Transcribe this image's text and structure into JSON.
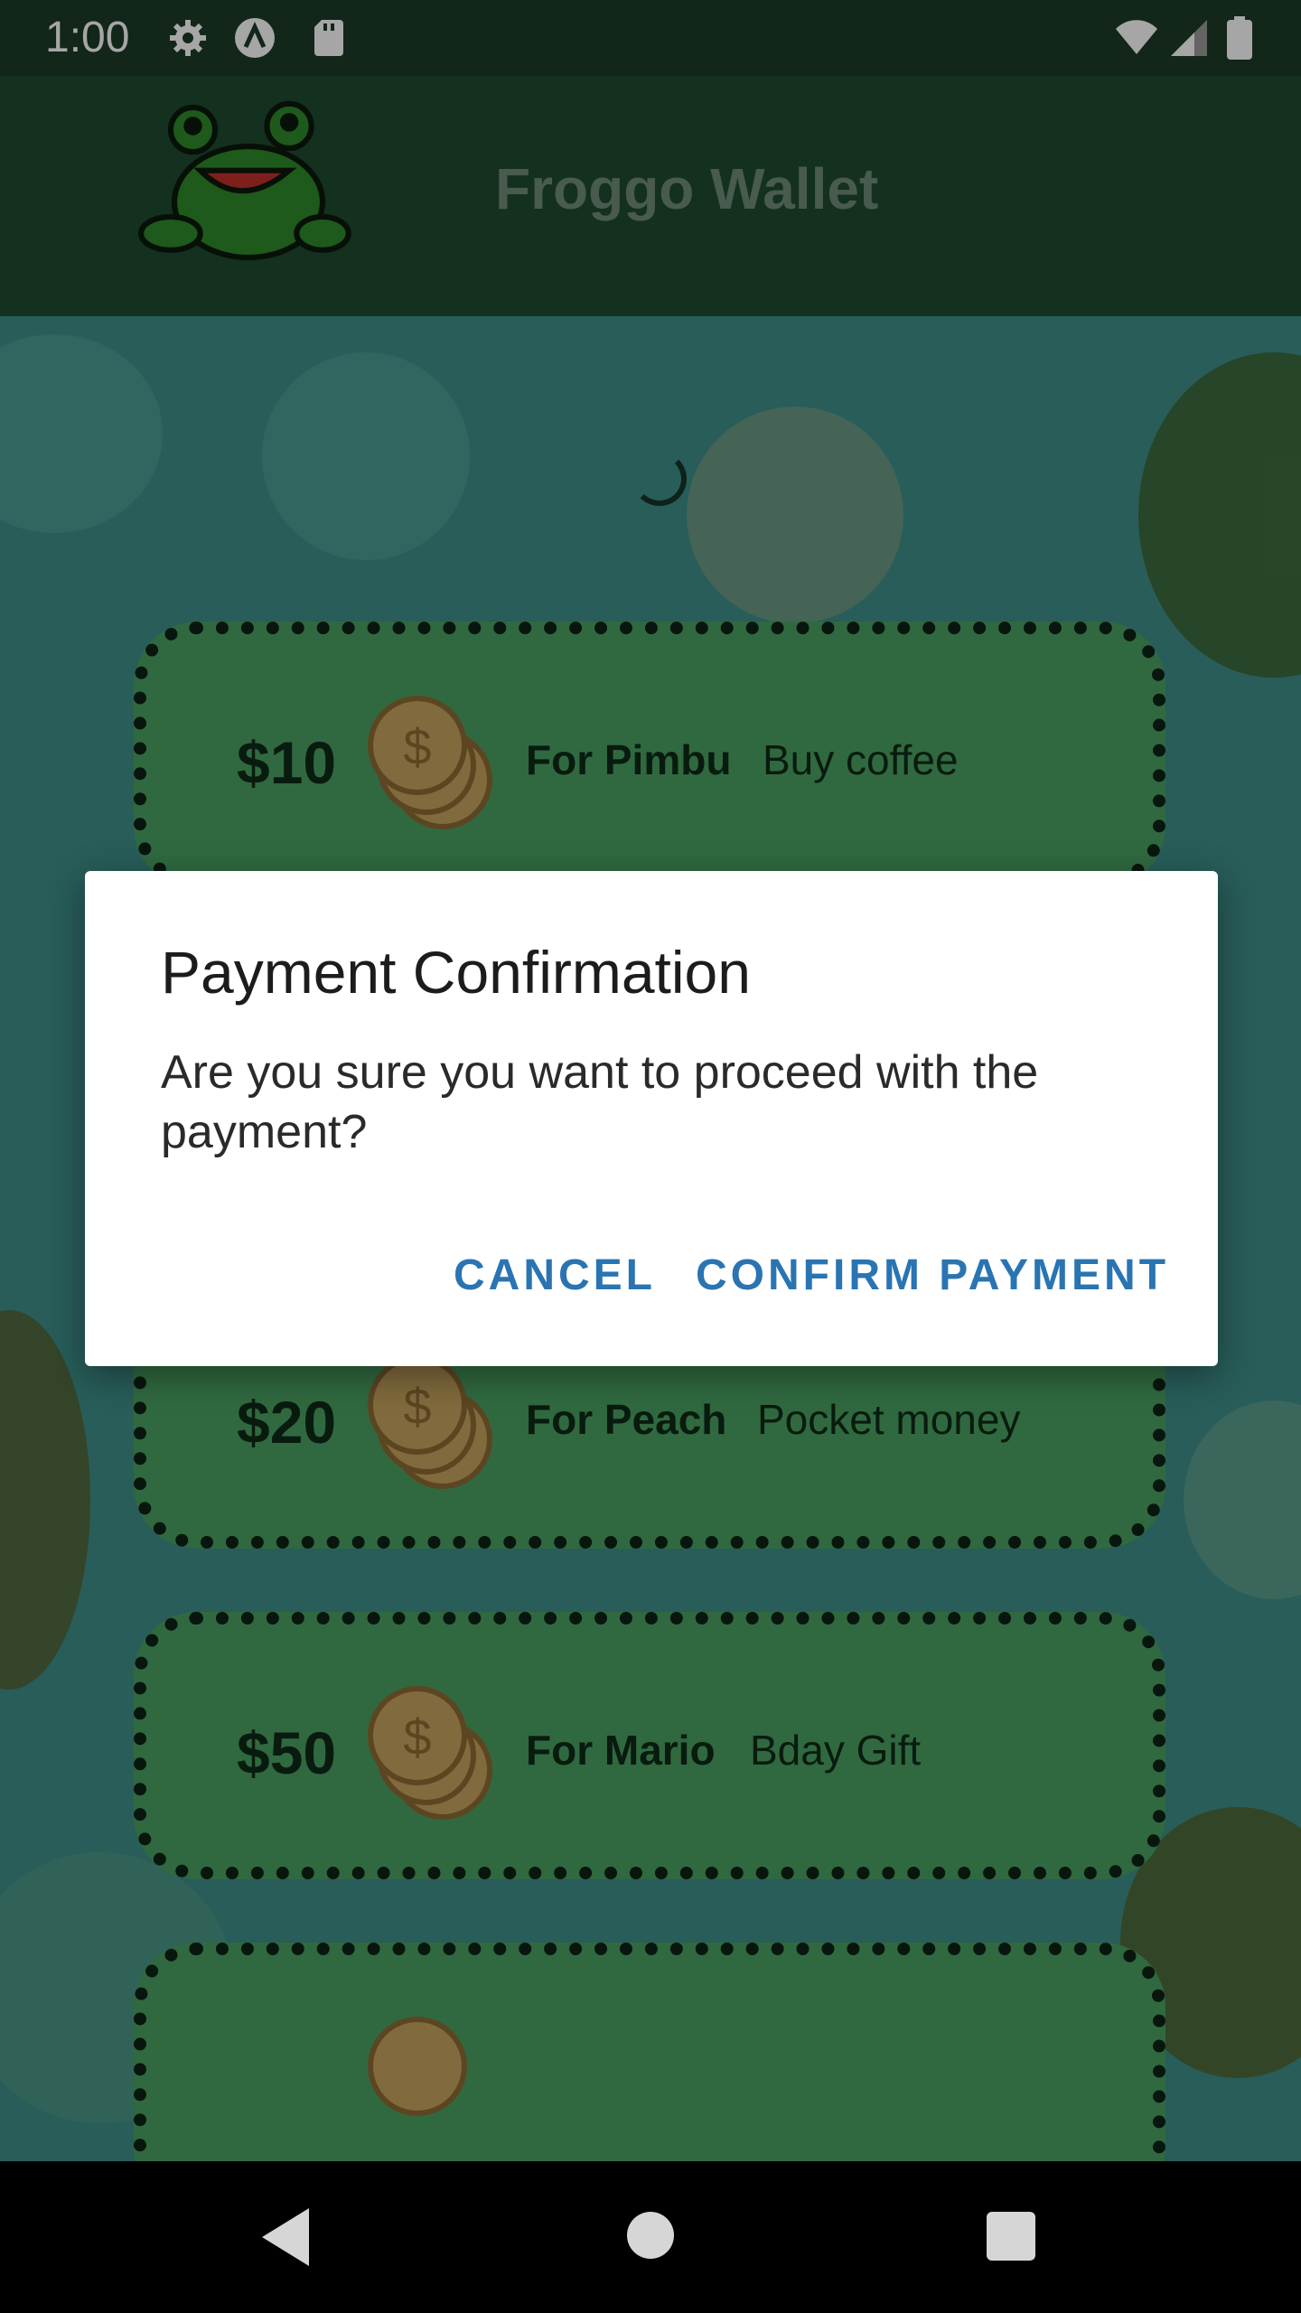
{
  "status_bar": {
    "time": "1:00",
    "icons_left": [
      "gear-icon",
      "a-circle-icon",
      "sd-card-icon"
    ],
    "icons_right": [
      "wifi-icon",
      "signal-icon",
      "battery-icon"
    ]
  },
  "app_bar": {
    "title": "Froggo Wallet",
    "logo": "frog-logo"
  },
  "payments": [
    {
      "amount": "$10",
      "recipient": "For Pimbu",
      "memo": "Buy coffee"
    },
    {
      "amount": "$20",
      "recipient": "For Peach",
      "memo": "Pocket money"
    },
    {
      "amount": "$50",
      "recipient": "For Mario",
      "memo": "Bday Gift"
    }
  ],
  "dialog": {
    "title": "Payment Confirmation",
    "message": "Are you sure you want to proceed with the payment?",
    "cancel_label": "CANCEL",
    "confirm_label": "CONFIRM PAYMENT"
  },
  "nav_bar": {
    "back": "back-icon",
    "home": "home-icon",
    "recents": "recents-icon"
  },
  "colors": {
    "status_bar": "#1c3b29",
    "app_bar": "#1f4b30",
    "background": "#3e8f89",
    "card": "#4aa163",
    "accent": "#2a74b2"
  }
}
